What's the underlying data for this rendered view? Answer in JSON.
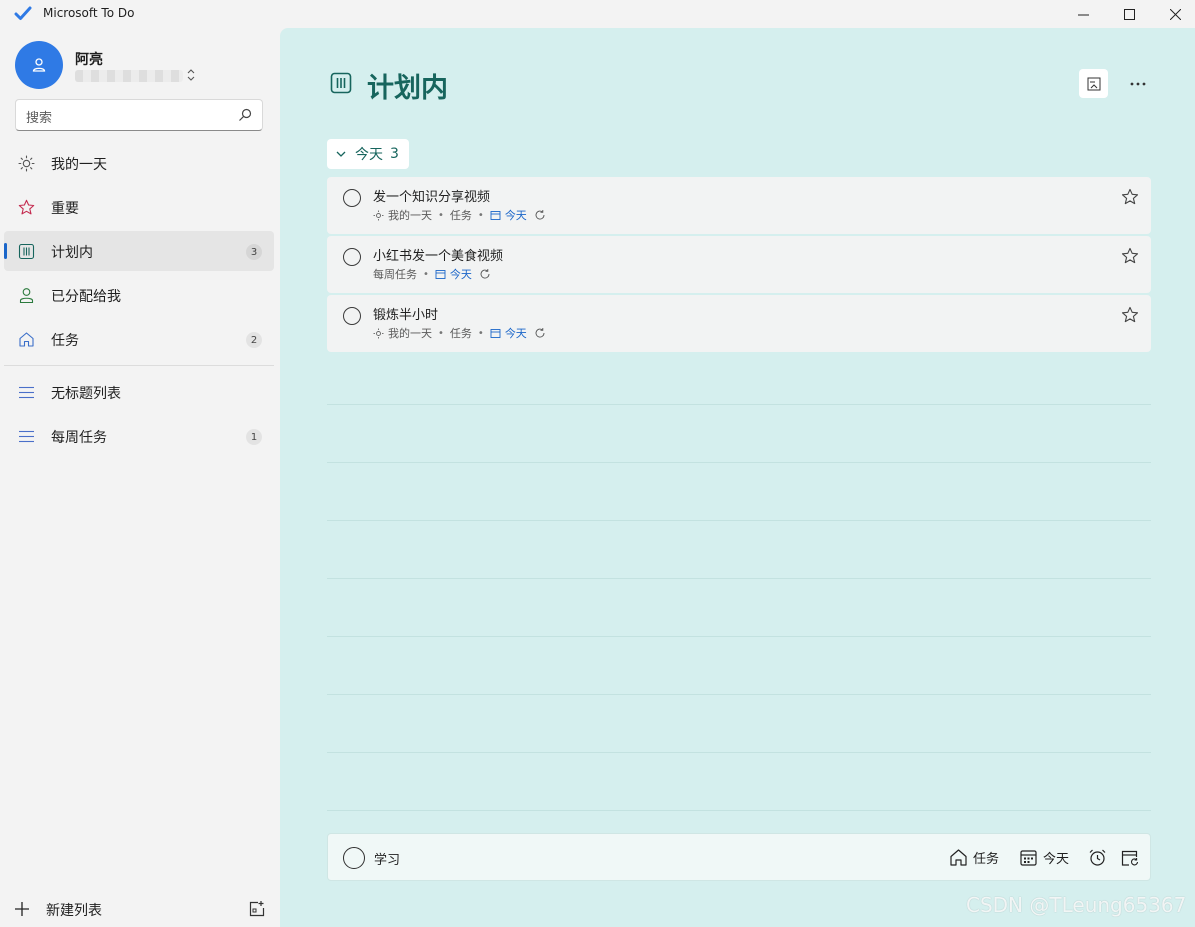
{
  "window": {
    "app_title": "Microsoft To Do",
    "controls": [
      "minimize",
      "maximize",
      "close"
    ]
  },
  "account": {
    "name": "阿亮",
    "email_blurred": true
  },
  "search": {
    "placeholder": "搜索"
  },
  "sidebar": {
    "smart_lists": [
      {
        "label": "我的一天",
        "icon": "sun-icon",
        "count": null
      },
      {
        "label": "重要",
        "icon": "star-icon",
        "count": null
      },
      {
        "label": "计划内",
        "icon": "calendar-grid-icon",
        "count": "3",
        "active": true
      },
      {
        "label": "已分配给我",
        "icon": "person-icon",
        "count": null
      },
      {
        "label": "任务",
        "icon": "home-icon",
        "count": "2"
      }
    ],
    "custom_lists": [
      {
        "label": "无标题列表",
        "icon": "list-icon",
        "count": null
      },
      {
        "label": "每周任务",
        "icon": "list-icon",
        "count": "1"
      }
    ],
    "new_list_label": "新建列表"
  },
  "main": {
    "title": "计划内",
    "group": {
      "label": "今天",
      "count": "3"
    },
    "tasks": [
      {
        "title": "发一个知识分享视频",
        "my_day": "我的一天",
        "list": "任务",
        "due": "今天",
        "repeat": true
      },
      {
        "title": "小红书发一个美食视频",
        "my_day": null,
        "list": "每周任务",
        "due": "今天",
        "repeat": true
      },
      {
        "title": "锻炼半小时",
        "my_day": "我的一天",
        "list": "任务",
        "due": "今天",
        "repeat": true
      }
    ],
    "add_task": {
      "value": "学习",
      "list_label": "任务",
      "due_label": "今天"
    }
  },
  "watermark": "CSDN @TLeung65367",
  "colors": {
    "accent_blue": "#2f7ae5",
    "title_teal": "#17655d",
    "main_bg": "#d5efee",
    "due_blue": "#1b66c9",
    "important_red": "#c42b4f"
  }
}
